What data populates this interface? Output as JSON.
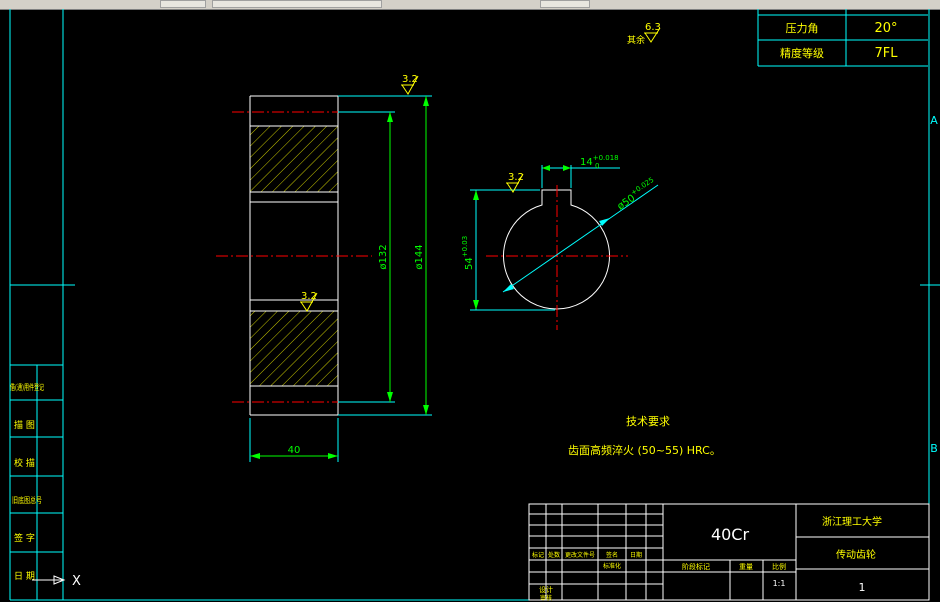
{
  "gear_params": [
    {
      "label": "压力角",
      "value": "20°"
    },
    {
      "label": "精度等级",
      "value": "7FL"
    }
  ],
  "surface_finish": {
    "other_label": "其余",
    "other_value": "6.3",
    "face": "3.2",
    "bore": "3.2",
    "tooth": "3.2"
  },
  "dimensions": {
    "d132": "ø132",
    "d144": "ø144",
    "width": "40",
    "keyway": "14",
    "keyway_tol_top": "+0.018",
    "keyway_tol_bottom": "0",
    "bore": "ø50",
    "bore_tol_top": "+0.025",
    "bore_tol_bottom": "0",
    "depth": "54",
    "depth_tol_top": "+0.03",
    "depth_tol_bottom": "0"
  },
  "tech_req": {
    "title": "技术要求",
    "text": "齿面高频淬火 (50~55) HRC。"
  },
  "zone_markers": [
    "A",
    "B"
  ],
  "left_panel": [
    "借(通)用件登记",
    "描  图",
    "校  描",
    "旧底图总号",
    "签  字",
    "日  期"
  ],
  "title_block": {
    "material": "40Cr",
    "school": "浙江理工大学",
    "part_name": "传动齿轮",
    "scale": "1:1",
    "sheet": "1",
    "row_labels": [
      "标记",
      "处数",
      "更改文件号",
      "签名",
      "日期"
    ],
    "designer_label": "设计",
    "standard_label": "标准化",
    "stage_label": "阶段标记",
    "weight_label": "重量",
    "scale_label": "比例",
    "review_label": "审核"
  },
  "ucs_label": "X",
  "colors": {
    "frame": "#00ffff",
    "outline": "#ffffff",
    "dim": "#00ff00",
    "center": "#ff0000",
    "hatch": "#ffff00",
    "text": "#ffff00"
  }
}
